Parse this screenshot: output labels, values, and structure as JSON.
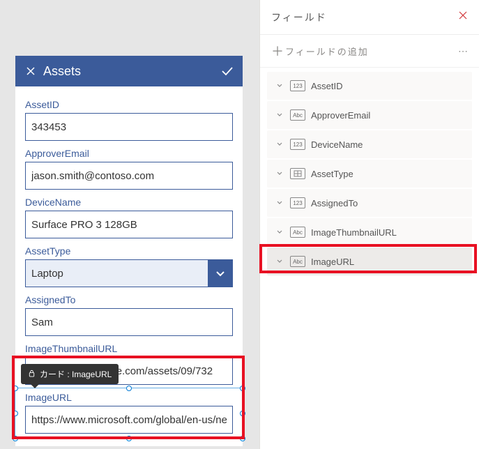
{
  "form": {
    "title": "Assets",
    "fields": {
      "assetId": {
        "label": "AssetID",
        "value": "343453"
      },
      "approver": {
        "label": "ApproverEmail",
        "value": "jason.smith@contoso.com"
      },
      "device": {
        "label": "DeviceName",
        "value": "Surface PRO 3 128GB"
      },
      "assetType": {
        "label": "AssetType",
        "value": "Laptop"
      },
      "assigned": {
        "label": "AssignedTo",
        "value": "Sam"
      },
      "thumb": {
        "label": "ImageThumbnailURL",
        "value": "https://www.surface.com/assets/09/732"
      },
      "imageUrl": {
        "label": "ImageURL",
        "value": "https://www.microsoft.com/global/en-us/ne"
      }
    }
  },
  "tooltip": {
    "text": "カード : ImageURL"
  },
  "panel": {
    "title": "フィールド",
    "addLabel": "フィールドの追加",
    "items": [
      {
        "label": "AssetID",
        "badge": "123"
      },
      {
        "label": "ApproverEmail",
        "badge": "Abc"
      },
      {
        "label": "DeviceName",
        "badge": "123"
      },
      {
        "label": "AssetType",
        "badge": "grid"
      },
      {
        "label": "AssignedTo",
        "badge": "123"
      },
      {
        "label": "ImageThumbnailURL",
        "badge": "Abc"
      },
      {
        "label": "ImageURL",
        "badge": "Abc",
        "selected": true
      }
    ]
  }
}
